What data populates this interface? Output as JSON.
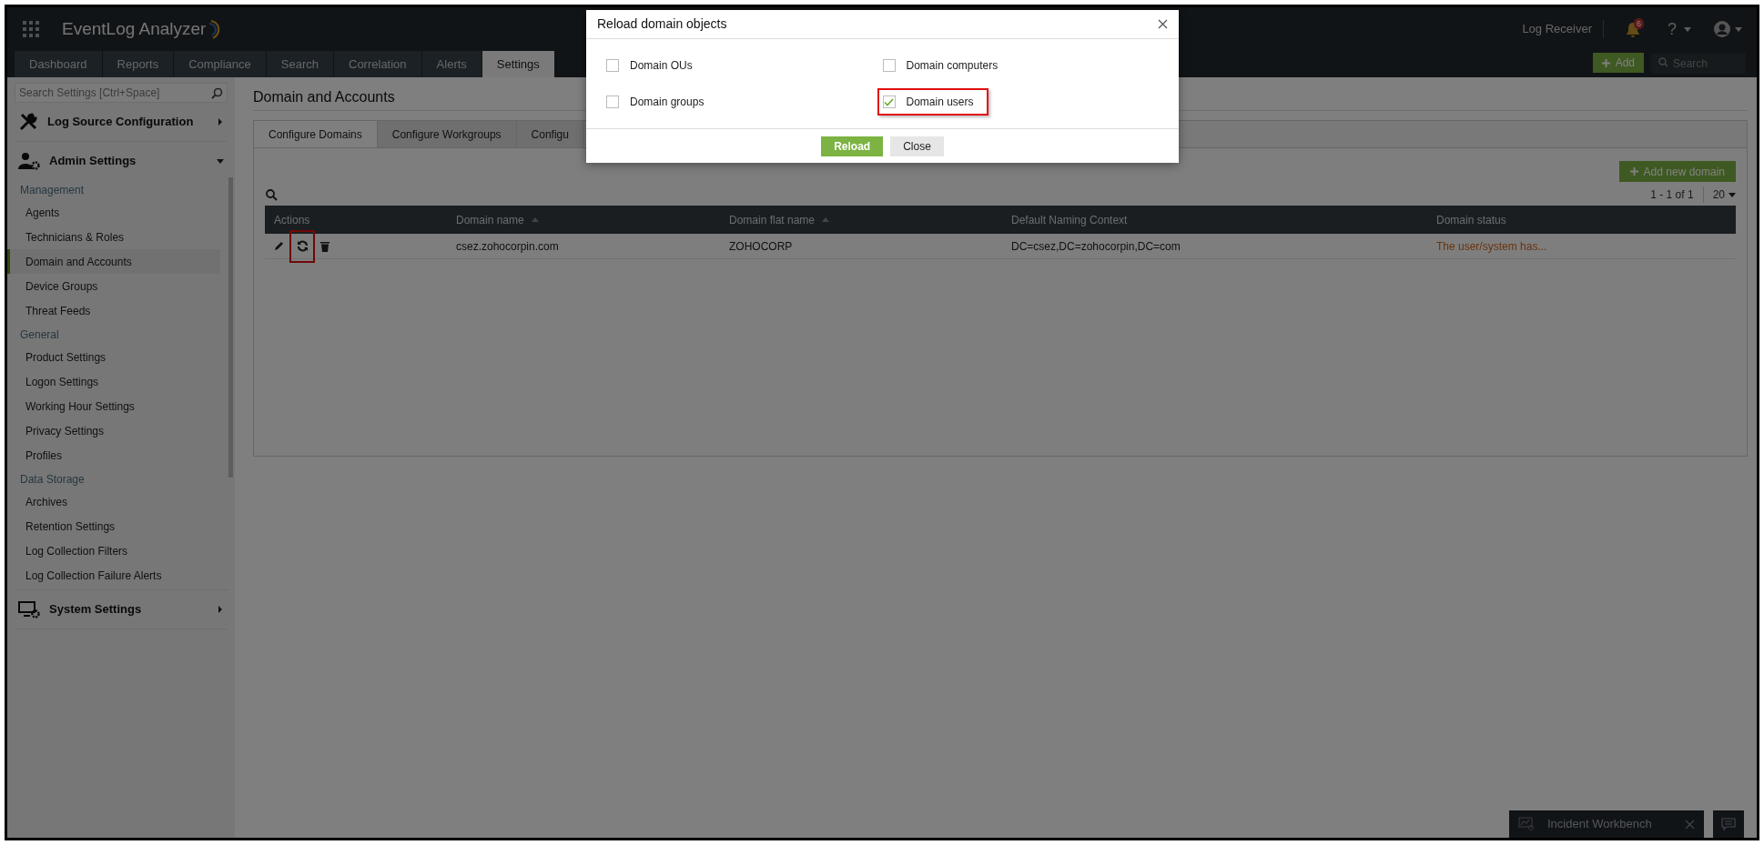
{
  "app": {
    "name": "EventLog Analyzer"
  },
  "header": {
    "log_receiver": "Log Receiver",
    "notification_count": "6",
    "help": "?",
    "add_button": "Add",
    "search_placeholder": "Search"
  },
  "nav_tabs": [
    {
      "label": "Dashboard",
      "selected": false
    },
    {
      "label": "Reports",
      "selected": false
    },
    {
      "label": "Compliance",
      "selected": false
    },
    {
      "label": "Search",
      "selected": false
    },
    {
      "label": "Correlation",
      "selected": false
    },
    {
      "label": "Alerts",
      "selected": false
    },
    {
      "label": "Settings",
      "selected": true
    }
  ],
  "sidebar": {
    "search_placeholder": "Search Settings [Ctrl+Space]",
    "sections": [
      {
        "label": "Log Source Configuration",
        "expanded": false
      },
      {
        "label": "Admin Settings",
        "expanded": true,
        "groups": [
          {
            "heading": "Management",
            "items": [
              {
                "label": "Agents",
                "selected": false
              },
              {
                "label": "Technicians & Roles",
                "selected": false
              },
              {
                "label": "Domain and Accounts",
                "selected": true
              },
              {
                "label": "Device Groups",
                "selected": false
              },
              {
                "label": "Threat Feeds",
                "selected": false
              }
            ]
          },
          {
            "heading": "General",
            "items": [
              {
                "label": "Product Settings",
                "selected": false
              },
              {
                "label": "Logon Settings",
                "selected": false
              },
              {
                "label": "Working Hour Settings",
                "selected": false
              },
              {
                "label": "Privacy Settings",
                "selected": false
              },
              {
                "label": "Profiles",
                "selected": false
              }
            ]
          },
          {
            "heading": "Data Storage",
            "items": [
              {
                "label": "Archives",
                "selected": false
              },
              {
                "label": "Retention Settings",
                "selected": false
              },
              {
                "label": "Log Collection Filters",
                "selected": false
              },
              {
                "label": "Log Collection Failure Alerts",
                "selected": false
              }
            ]
          }
        ]
      },
      {
        "label": "System Settings",
        "expanded": false
      }
    ]
  },
  "page": {
    "title": "Domain and Accounts",
    "tabs": [
      {
        "label": "Configure Domains",
        "selected": true
      },
      {
        "label": "Configure Workgroups",
        "selected": false
      },
      {
        "label": "Configu",
        "selected": false
      }
    ],
    "add_button": "Add new domain",
    "pagination": "1 - 1 of 1",
    "page_size": "20",
    "table": {
      "columns": [
        {
          "label": "Actions",
          "sortable": false
        },
        {
          "label": "Domain name",
          "sortable": true
        },
        {
          "label": "Domain flat name",
          "sortable": true
        },
        {
          "label": "Default Naming Context",
          "sortable": false
        },
        {
          "label": "Domain status",
          "sortable": false
        }
      ],
      "rows": [
        {
          "reload_highlighted": true,
          "cells": [
            "",
            "csez.zohocorpin.com",
            "ZOHOCORP",
            "DC=csez,DC=zohocorpin,DC=com",
            "The user/system has..."
          ]
        }
      ]
    }
  },
  "dialog": {
    "title": "Reload domain objects",
    "options": [
      {
        "label": "Domain OUs",
        "checked": false,
        "highlighted": false
      },
      {
        "label": "Domain computers",
        "checked": false,
        "highlighted": false
      },
      {
        "label": "Domain groups",
        "checked": false,
        "highlighted": false
      },
      {
        "label": "Domain users",
        "checked": true,
        "highlighted": true
      }
    ],
    "buttons": [
      {
        "label": "Reload",
        "kind": "primary"
      },
      {
        "label": "Close",
        "kind": "secondary"
      }
    ]
  },
  "incident_workbench": {
    "label": "Incident Workbench"
  }
}
